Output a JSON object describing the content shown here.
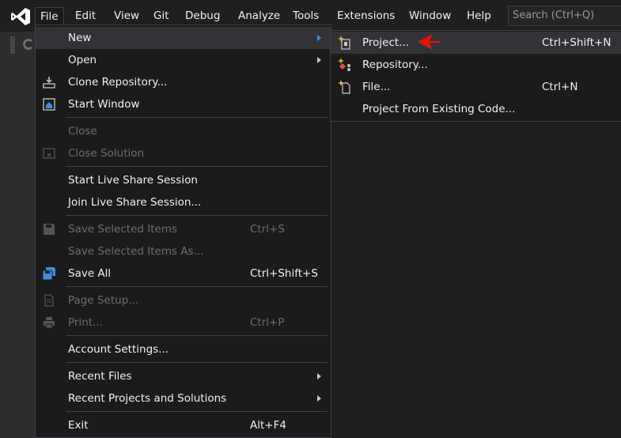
{
  "menubar": {
    "items": [
      "File",
      "Edit",
      "View",
      "Git",
      "Debug",
      "Analyze",
      "Tools",
      "Extensions",
      "Window",
      "Help"
    ],
    "active": "File",
    "search_placeholder": "Search (Ctrl+Q)"
  },
  "file_menu": {
    "items": [
      {
        "label": "New",
        "submenu": true,
        "highlight": true
      },
      {
        "label": "Open",
        "submenu": true
      },
      {
        "label": "Clone Repository...",
        "icon": "clone-repository-icon"
      },
      {
        "label": "Start Window",
        "icon": "start-window-icon"
      },
      {
        "label": "Close",
        "disabled": true
      },
      {
        "label": "Close Solution",
        "disabled": true,
        "icon": "close-solution-icon"
      },
      {
        "label": "Start Live Share Session"
      },
      {
        "label": "Join Live Share Session..."
      },
      {
        "label": "Save Selected Items",
        "shortcut": "Ctrl+S",
        "disabled": true,
        "icon": "save-icon"
      },
      {
        "label": "Save Selected Items As...",
        "disabled": true
      },
      {
        "label": "Save All",
        "shortcut": "Ctrl+Shift+S",
        "icon": "save-all-icon"
      },
      {
        "label": "Page Setup...",
        "disabled": true,
        "icon": "page-setup-icon"
      },
      {
        "label": "Print...",
        "shortcut": "Ctrl+P",
        "disabled": true,
        "icon": "print-icon"
      },
      {
        "label": "Account Settings..."
      },
      {
        "label": "Recent Files",
        "submenu": true
      },
      {
        "label": "Recent Projects and Solutions",
        "submenu": true
      },
      {
        "label": "Exit",
        "shortcut": "Alt+F4"
      }
    ]
  },
  "new_submenu": {
    "items": [
      {
        "label": "Project...",
        "shortcut": "Ctrl+Shift+N",
        "icon": "new-project-icon",
        "highlight": true
      },
      {
        "label": "Repository...",
        "icon": "new-repository-icon"
      },
      {
        "label": "File...",
        "shortcut": "Ctrl+N",
        "icon": "new-file-icon"
      },
      {
        "label": "Project From Existing Code..."
      }
    ]
  },
  "annotation": {
    "color": "#e51400",
    "icon": "red-arrow-pointer"
  },
  "colors": {
    "background": "#1e1e1e",
    "menu_bg": "#1b1b1c",
    "menu_border": "#3f3f46",
    "highlight": "#333337",
    "text": "#f1f1f1",
    "disabled_text": "#6d6d6d",
    "vs_purple": "#ffffff"
  }
}
